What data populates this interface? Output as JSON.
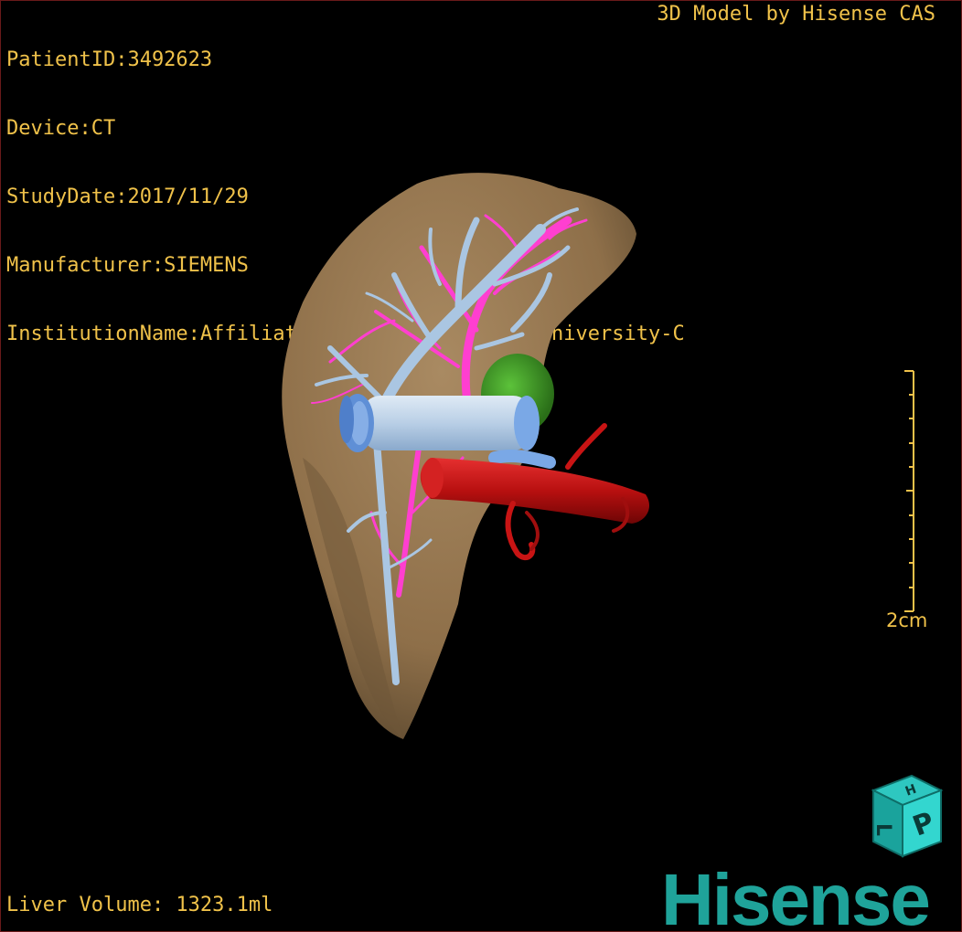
{
  "patient_info": {
    "patient_id": "PatientID:3492623",
    "device": "Device:CT",
    "study_date": "StudyDate:2017/11/29",
    "manufacturer": "Manufacturer:SIEMENS",
    "institution": "InstitutionName:Affiliated Hospital Qingdao University-C"
  },
  "brand_text": "3D Model by Hisense CAS",
  "liver_volume": "Liver Volume: 1323.1ml",
  "scale_bar": {
    "label": "2cm"
  },
  "logo": {
    "text": "Hisense"
  },
  "orientation_cube": {
    "top_face": "H",
    "front_face": "P",
    "side_face": "L"
  },
  "colors": {
    "overlay_text": "#f0c24a",
    "liver": "#9b7a52",
    "portal_vein": "#a9c4e0",
    "hepatic_vein": "#ff3fd0",
    "artery": "#c81414",
    "gallbladder": "#3f9a2a",
    "ivc": "#7aa8e6",
    "brand": "#1fa39a"
  }
}
